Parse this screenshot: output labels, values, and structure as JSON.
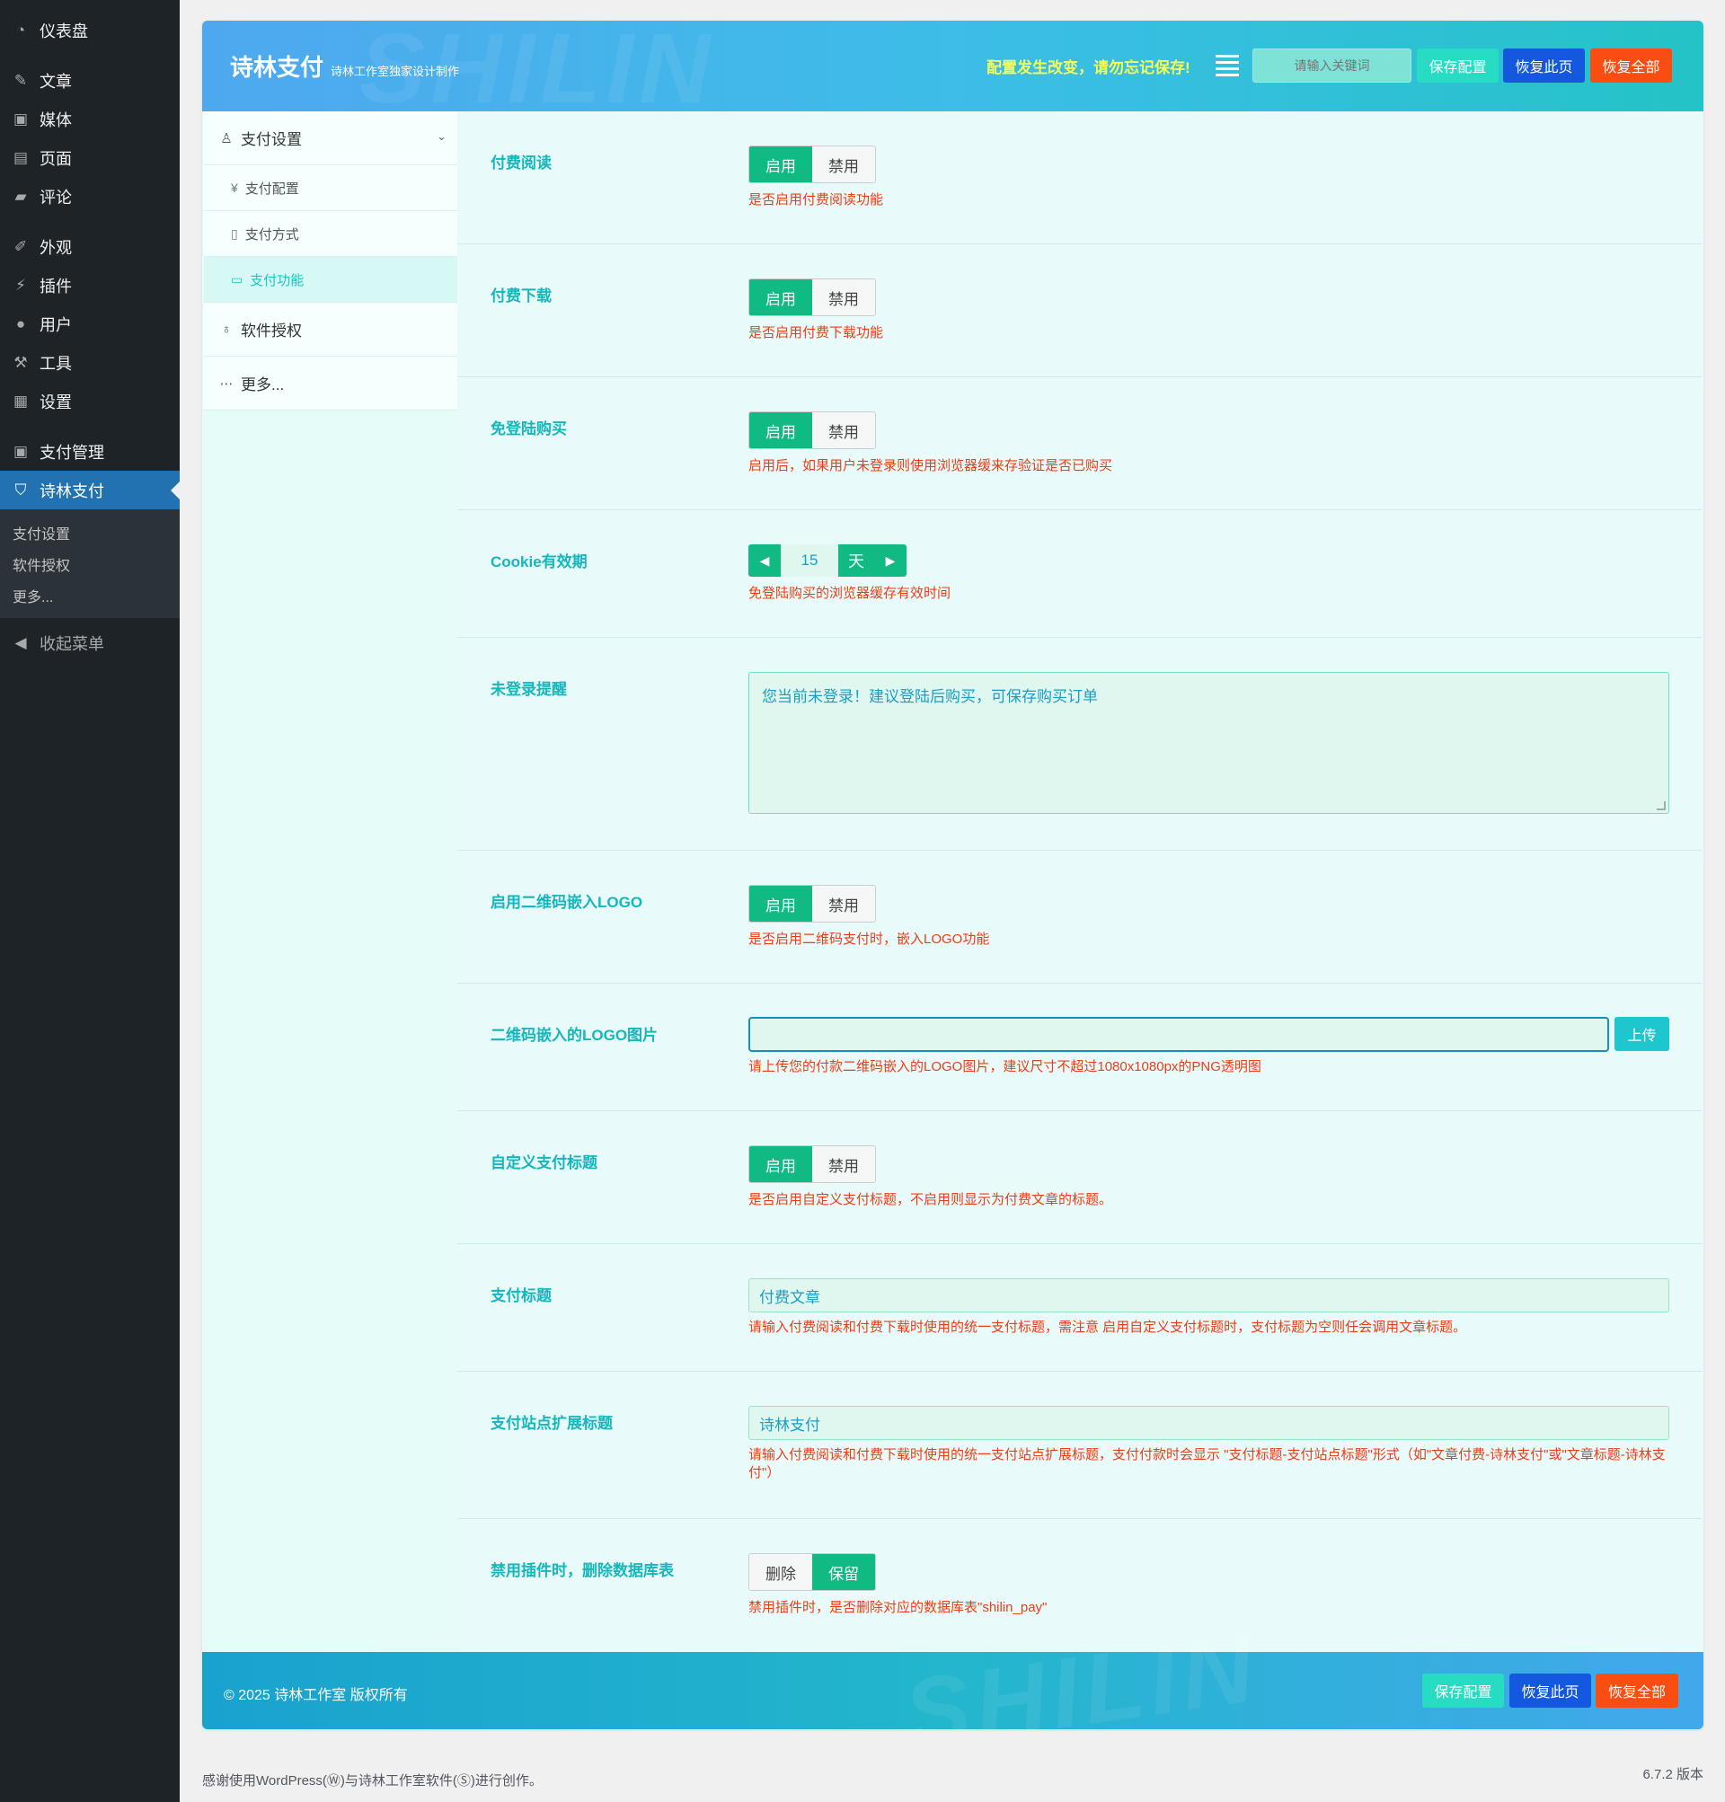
{
  "wp_menu": {
    "items": [
      {
        "label": "仪表盘",
        "icon": "dashboard-icon"
      },
      {
        "label": "文章",
        "icon": "pin-icon"
      },
      {
        "label": "媒体",
        "icon": "media-icon"
      },
      {
        "label": "页面",
        "icon": "page-icon"
      },
      {
        "label": "评论",
        "icon": "comment-icon"
      },
      {
        "label": "外观",
        "icon": "brush-icon"
      },
      {
        "label": "插件",
        "icon": "plugin-icon"
      },
      {
        "label": "用户",
        "icon": "user-icon"
      },
      {
        "label": "工具",
        "icon": "wrench-icon"
      },
      {
        "label": "设置",
        "icon": "settings-icon"
      },
      {
        "label": "支付管理",
        "icon": "payment-icon"
      },
      {
        "label": "诗林支付",
        "icon": "shield-icon"
      }
    ],
    "submenu": [
      "支付设置",
      "软件授权",
      "更多..."
    ],
    "collapse_label": "收起菜单",
    "active_color": "#2271b1"
  },
  "header": {
    "title": "诗林支付",
    "subtitle": "诗林工作室独家设计制作",
    "watermark": "SHILIN",
    "notice": "配置发生改变，请勿忘记保存!",
    "search_placeholder": "请输入关键词",
    "save_label": "保存配置",
    "restore_label": "恢复此页",
    "restore_all_label": "恢复全部"
  },
  "nav": {
    "group_payment": "支付设置",
    "sub_config": "支付配置",
    "sub_method": "支付方式",
    "sub_function": "支付功能",
    "group_license": "软件授权",
    "group_more": "更多..."
  },
  "fields": {
    "paid_read": {
      "label": "付费阅读",
      "on": "启用",
      "off": "禁用",
      "hint": "是否启用付费阅读功能"
    },
    "paid_download": {
      "label": "付费下载",
      "on": "启用",
      "off": "禁用",
      "hint": "是否启用付费下载功能"
    },
    "guest_buy": {
      "label": "免登陆购买",
      "on": "启用",
      "off": "禁用",
      "hint": "启用后，如果用户未登录则使用浏览器缓来存验证是否已购买"
    },
    "cookie": {
      "label": "Cookie有效期",
      "value": "15",
      "unit": "天",
      "hint": "免登陆购买的浏览器缓存有效时间"
    },
    "login_notice": {
      "label": "未登录提醒",
      "value": "您当前未登录！建议登陆后购买，可保存购买订单"
    },
    "qr_logo": {
      "label": "启用二维码嵌入LOGO",
      "on": "启用",
      "off": "禁用",
      "hint": "是否启用二维码支付时，嵌入LOGO功能"
    },
    "qr_logo_image": {
      "label": "二维码嵌入的LOGO图片",
      "upload_label": "上传",
      "hint": "请上传您的付款二维码嵌入的LOGO图片，建议尺寸不超过1080x1080px的PNG透明图"
    },
    "custom_title": {
      "label": "自定义支付标题",
      "on": "启用",
      "off": "禁用",
      "hint": "是否启用自定义支付标题，不启用则显示为付费文章的标题。"
    },
    "pay_title": {
      "label": "支付标题",
      "value": "付费文章",
      "hint": "请输入付费阅读和付费下载时使用的统一支付标题，需注意 启用自定义支付标题时，支付标题为空则任会调用文章标题。"
    },
    "site_title": {
      "label": "支付站点扩展标题",
      "value": "诗林支付",
      "hint": "请输入付费阅读和付费下载时使用的统一支付站点扩展标题，支付付款时会显示 \"支付标题-支付站点标题\"形式（如\"文章付费-诗林支付\"或\"文章标题-诗林支付\"）"
    },
    "uninstall": {
      "label": "禁用插件时，删除数据库表",
      "delete": "删除",
      "keep": "保留",
      "hint": "禁用插件时，是否删除对应的数据库表\"shilin_pay\""
    }
  },
  "footer": {
    "copyright": "© 2025 诗林工作室 版权所有",
    "save_label": "保存配置",
    "restore_label": "恢复此页",
    "restore_all_label": "恢复全部"
  },
  "wp_footer": {
    "left": "感谢使用WordPress(Ⓦ)与诗林工作室软件(Ⓢ)进行创作。",
    "version": "6.7.2 版本"
  },
  "colors": {
    "accent": "#15b7bc",
    "toggle_on": "#11b983",
    "hint": "#ef3c14",
    "save": "#27dcc2",
    "restore": "#1558e0",
    "restore_all": "#fa4d12"
  }
}
